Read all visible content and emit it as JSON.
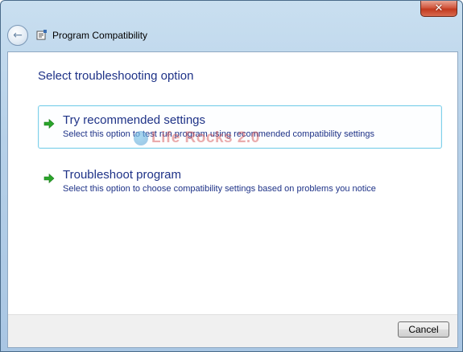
{
  "window": {
    "title": "Program Compatibility",
    "close_glyph": "✕"
  },
  "main": {
    "heading": "Select troubleshooting option",
    "options": [
      {
        "title": "Try recommended settings",
        "description": "Select this option to test run program using recommended compatibility settings",
        "icon": "green-arrow-icon"
      },
      {
        "title": "Troubleshoot program",
        "description": "Select this option to choose compatibility settings based on problems you notice",
        "icon": "green-arrow-icon"
      }
    ],
    "watermark": "Life Rocks 2.0"
  },
  "footer": {
    "cancel_label": "Cancel"
  },
  "colors": {
    "heading_blue": "#1e3287",
    "hover_border": "#7fd0ea",
    "arrow_green": "#2aa52a"
  }
}
